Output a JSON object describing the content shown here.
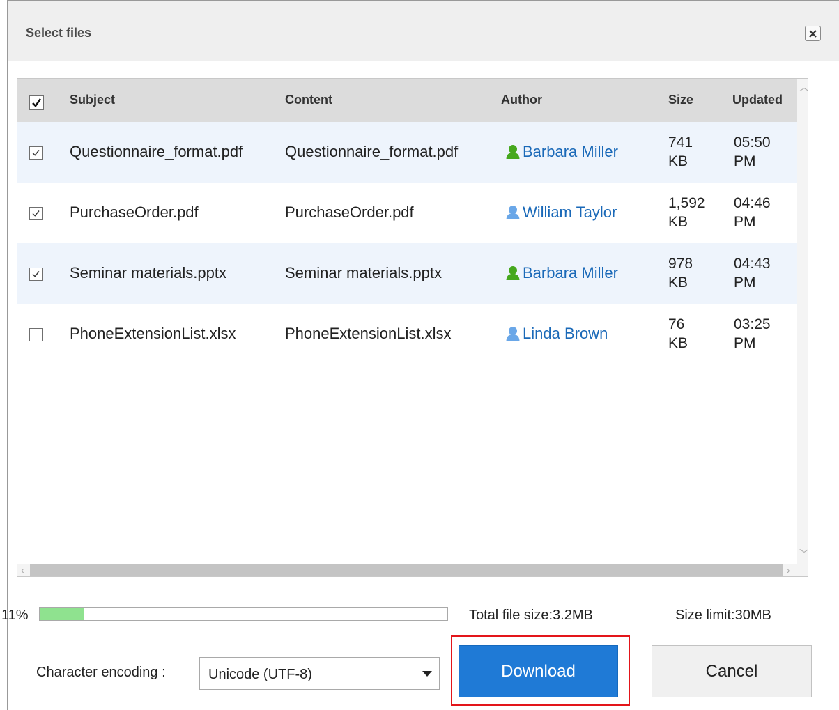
{
  "dialog": {
    "title": "Select files"
  },
  "table": {
    "headers": {
      "subject": "Subject",
      "content": "Content",
      "author": "Author",
      "size": "Size",
      "updated": "Updated"
    },
    "rows": [
      {
        "checked": true,
        "subject": "Questionnaire_format.pdf",
        "content": "Questionnaire_format.pdf",
        "author": "Barbara Miller",
        "author_icon": "user-green-icon",
        "size_value": "741",
        "size_unit": "KB",
        "time": "05:50",
        "ampm": "PM"
      },
      {
        "checked": true,
        "subject": "PurchaseOrder.pdf",
        "content": "PurchaseOrder.pdf",
        "author": "William Taylor",
        "author_icon": "user-blue-icon",
        "size_value": "1,592",
        "size_unit": "KB",
        "time": "04:46",
        "ampm": "PM"
      },
      {
        "checked": true,
        "subject": "Seminar materials.pptx",
        "content": "Seminar materials.pptx",
        "author": "Barbara Miller",
        "author_icon": "user-green-icon",
        "size_value": "978",
        "size_unit": "KB",
        "time": "04:43",
        "ampm": "PM"
      },
      {
        "checked": false,
        "subject": "PhoneExtensionList.xlsx",
        "content": "PhoneExtensionList.xlsx",
        "author": "Linda Brown",
        "author_icon": "user-blue-icon",
        "size_value": "76",
        "size_unit": "KB",
        "time": "03:25",
        "ampm": "PM"
      }
    ]
  },
  "footer": {
    "progress_label": "11%",
    "progress_value": 0.11,
    "total_size": "Total file size:3.2MB",
    "size_limit": "Size limit:30MB",
    "encoding_label": "Character encoding :",
    "encoding_value": "Unicode (UTF-8)",
    "download_label": "Download",
    "cancel_label": "Cancel"
  },
  "colors": {
    "accent": "#1f7ad6",
    "link": "#1a69b8",
    "progress": "#8fe28f",
    "highlight": "#e3151a",
    "row_shade": "#eef4fc"
  }
}
